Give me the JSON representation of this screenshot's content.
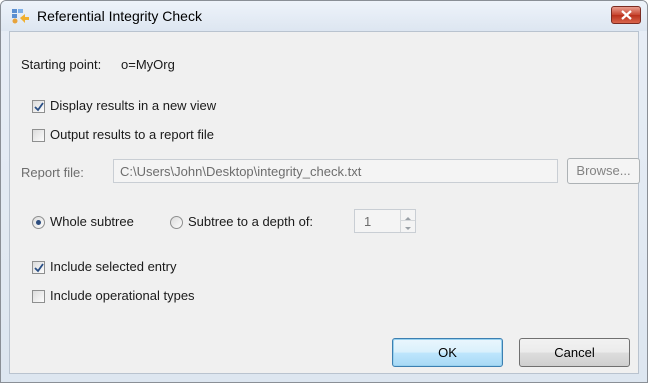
{
  "window": {
    "title": "Referential Integrity Check"
  },
  "starting_point": {
    "label": "Starting point:",
    "value": "o=MyOrg"
  },
  "options": {
    "display_new_view": {
      "label": "Display results in a new view",
      "checked": true
    },
    "output_report_file": {
      "label": "Output results to a report file",
      "checked": false
    }
  },
  "report_file": {
    "label": "Report file:",
    "value": "C:\\Users\\John\\Desktop\\integrity_check.txt",
    "browse_label": "Browse..."
  },
  "scope": {
    "whole_subtree_label": "Whole subtree",
    "whole_subtree_selected": true,
    "depth_label": "Subtree to a depth of:",
    "depth_selected": false,
    "depth_value": "1"
  },
  "include": {
    "selected_entry": {
      "label": "Include selected entry",
      "checked": true
    },
    "operational_types": {
      "label": "Include operational types",
      "checked": false
    }
  },
  "buttons": {
    "ok": "OK",
    "cancel": "Cancel"
  },
  "icons": {
    "app": "integrity-check-icon",
    "close": "close-icon",
    "check": "checkmark-icon"
  },
  "colors": {
    "close_button": "#c7442f",
    "default_button_border": "#3c7fb1",
    "dialog_background": "#f0f0f0"
  }
}
